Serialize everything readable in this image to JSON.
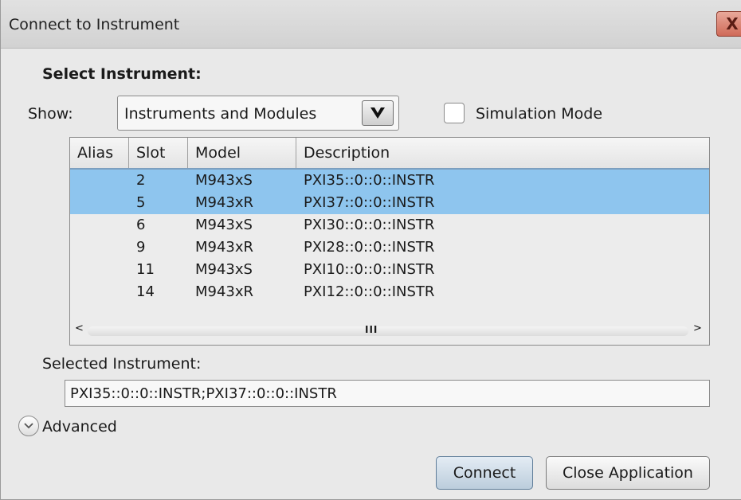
{
  "window": {
    "title": "Connect to Instrument",
    "close_glyph": "X"
  },
  "heading": "Select Instrument:",
  "show": {
    "label": "Show:",
    "selected": "Instruments and Modules",
    "arrow_glyph": "V"
  },
  "simulation_mode": {
    "label": "Simulation Mode",
    "checked": false
  },
  "table": {
    "columns": [
      "Alias",
      "Slot",
      "Model",
      "Description"
    ],
    "rows": [
      {
        "alias": "",
        "slot": "2",
        "model": "M943xS",
        "description": "PXI35::0::0::INSTR",
        "selected": true
      },
      {
        "alias": "",
        "slot": "5",
        "model": "M943xR",
        "description": "PXI37::0::0::INSTR",
        "selected": true
      },
      {
        "alias": "",
        "slot": "6",
        "model": "M943xS",
        "description": "PXI30::0::0::INSTR",
        "selected": false
      },
      {
        "alias": "",
        "slot": "9",
        "model": "M943xR",
        "description": "PXI28::0::0::INSTR",
        "selected": false
      },
      {
        "alias": "",
        "slot": "11",
        "model": "M943xS",
        "description": "PXI10::0::0::INSTR",
        "selected": false
      },
      {
        "alias": "",
        "slot": "14",
        "model": "M943xR",
        "description": "PXI12::0::0::INSTR",
        "selected": false
      }
    ],
    "scroll_left": "<",
    "scroll_right": ">",
    "scroll_grip": "III"
  },
  "selected_instrument": {
    "label": "Selected Instrument:",
    "value": "PXI35::0::0::INSTR;PXI37::0::0::INSTR"
  },
  "advanced": {
    "label": "Advanced",
    "icon": "chevron-down-circle-icon"
  },
  "buttons": {
    "connect": "Connect",
    "close_application": "Close Application"
  },
  "colors": {
    "selection": "#8ec5ee",
    "header_rule": "#7d9fbf",
    "close_button": "#cf6a58"
  }
}
